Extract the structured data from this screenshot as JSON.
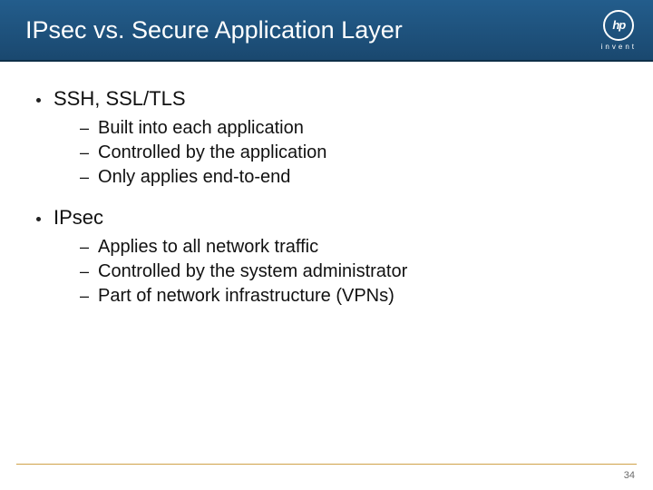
{
  "header": {
    "title": "IPsec vs. Secure Application Layer",
    "logo": {
      "mark": "hp",
      "subtext": "invent"
    }
  },
  "content": {
    "items": [
      {
        "label": "SSH, SSL/TLS",
        "subitems": [
          "Built into each application",
          "Controlled by the application",
          "Only applies end-to-end"
        ]
      },
      {
        "label": "IPsec",
        "subitems": [
          "Applies to all network traffic",
          "Controlled by the system administrator",
          "Part of network infrastructure (VPNs)"
        ]
      }
    ]
  },
  "footer": {
    "page_number": "34"
  }
}
